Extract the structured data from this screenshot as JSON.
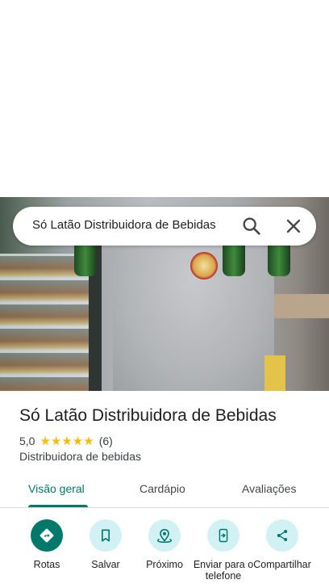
{
  "search": {
    "query": "Só Latão Distribuidora de Bebidas"
  },
  "place": {
    "name": "Só Latão Distribuidora de Bebidas",
    "rating": "5,0",
    "stars": "★★★★★",
    "review_count": "(6)",
    "category": "Distribuidora de bebidas"
  },
  "tabs": [
    {
      "label": "Visão geral",
      "active": true
    },
    {
      "label": "Cardápio",
      "active": false
    },
    {
      "label": "Avaliações",
      "active": false
    }
  ],
  "actions": [
    {
      "label": "Rotas",
      "icon": "directions-icon"
    },
    {
      "label": "Salvar",
      "icon": "bookmark-icon"
    },
    {
      "label": "Próximo",
      "icon": "nearby-icon"
    },
    {
      "label": "Enviar para o telefone",
      "icon": "send-to-phone-icon"
    },
    {
      "label": "Compartilhar",
      "icon": "share-icon"
    }
  ],
  "colors": {
    "accent": "#00796b",
    "action_bg": "#d2f1f4",
    "star": "#fbbc04"
  }
}
